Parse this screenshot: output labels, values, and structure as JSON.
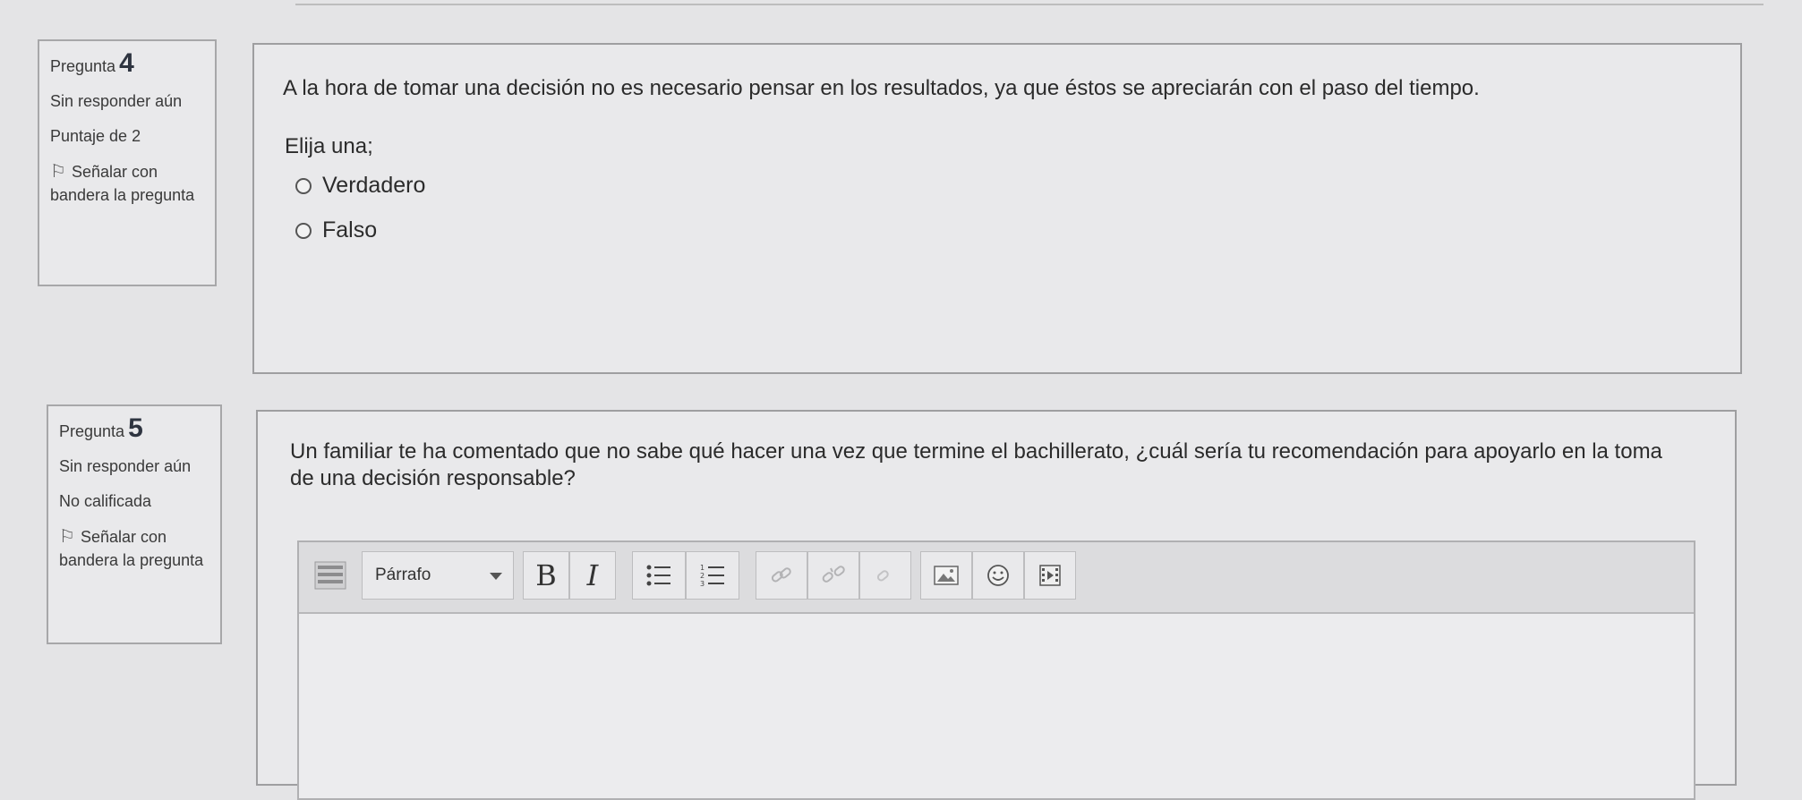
{
  "q4": {
    "label": "Pregunta",
    "number": "4",
    "state": "Sin responder aún",
    "grade": "Puntaje de 2",
    "flag_label": "Señalar con bandera la pregunta",
    "question": "A la hora de tomar una decisión no es necesario pensar en los resultados, ya que éstos se apreciarán con el paso del tiempo.",
    "prompt": "Elija una;",
    "options": [
      "Verdadero",
      "Falso"
    ]
  },
  "q5": {
    "label": "Pregunta",
    "number": "5",
    "state": "Sin responder aún",
    "grade": "No calificada",
    "flag_label": "Señalar con bandera la pregunta",
    "question": "Un familiar te ha comentado que no sabe qué hacer una vez que termine el bachillerato, ¿cuál sería tu recomendación para apoyarlo en la toma de una decisión responsable?",
    "editor": {
      "format_value": "Párrafo",
      "bold": "B",
      "italic": "I",
      "text_value": ""
    }
  },
  "icons": [
    "flag-icon",
    "toolbar-toggle-icon",
    "unordered-list-icon",
    "ordered-list-icon",
    "link-icon",
    "unlink-icon",
    "anchor-icon",
    "image-icon",
    "emoji-icon",
    "media-icon"
  ]
}
